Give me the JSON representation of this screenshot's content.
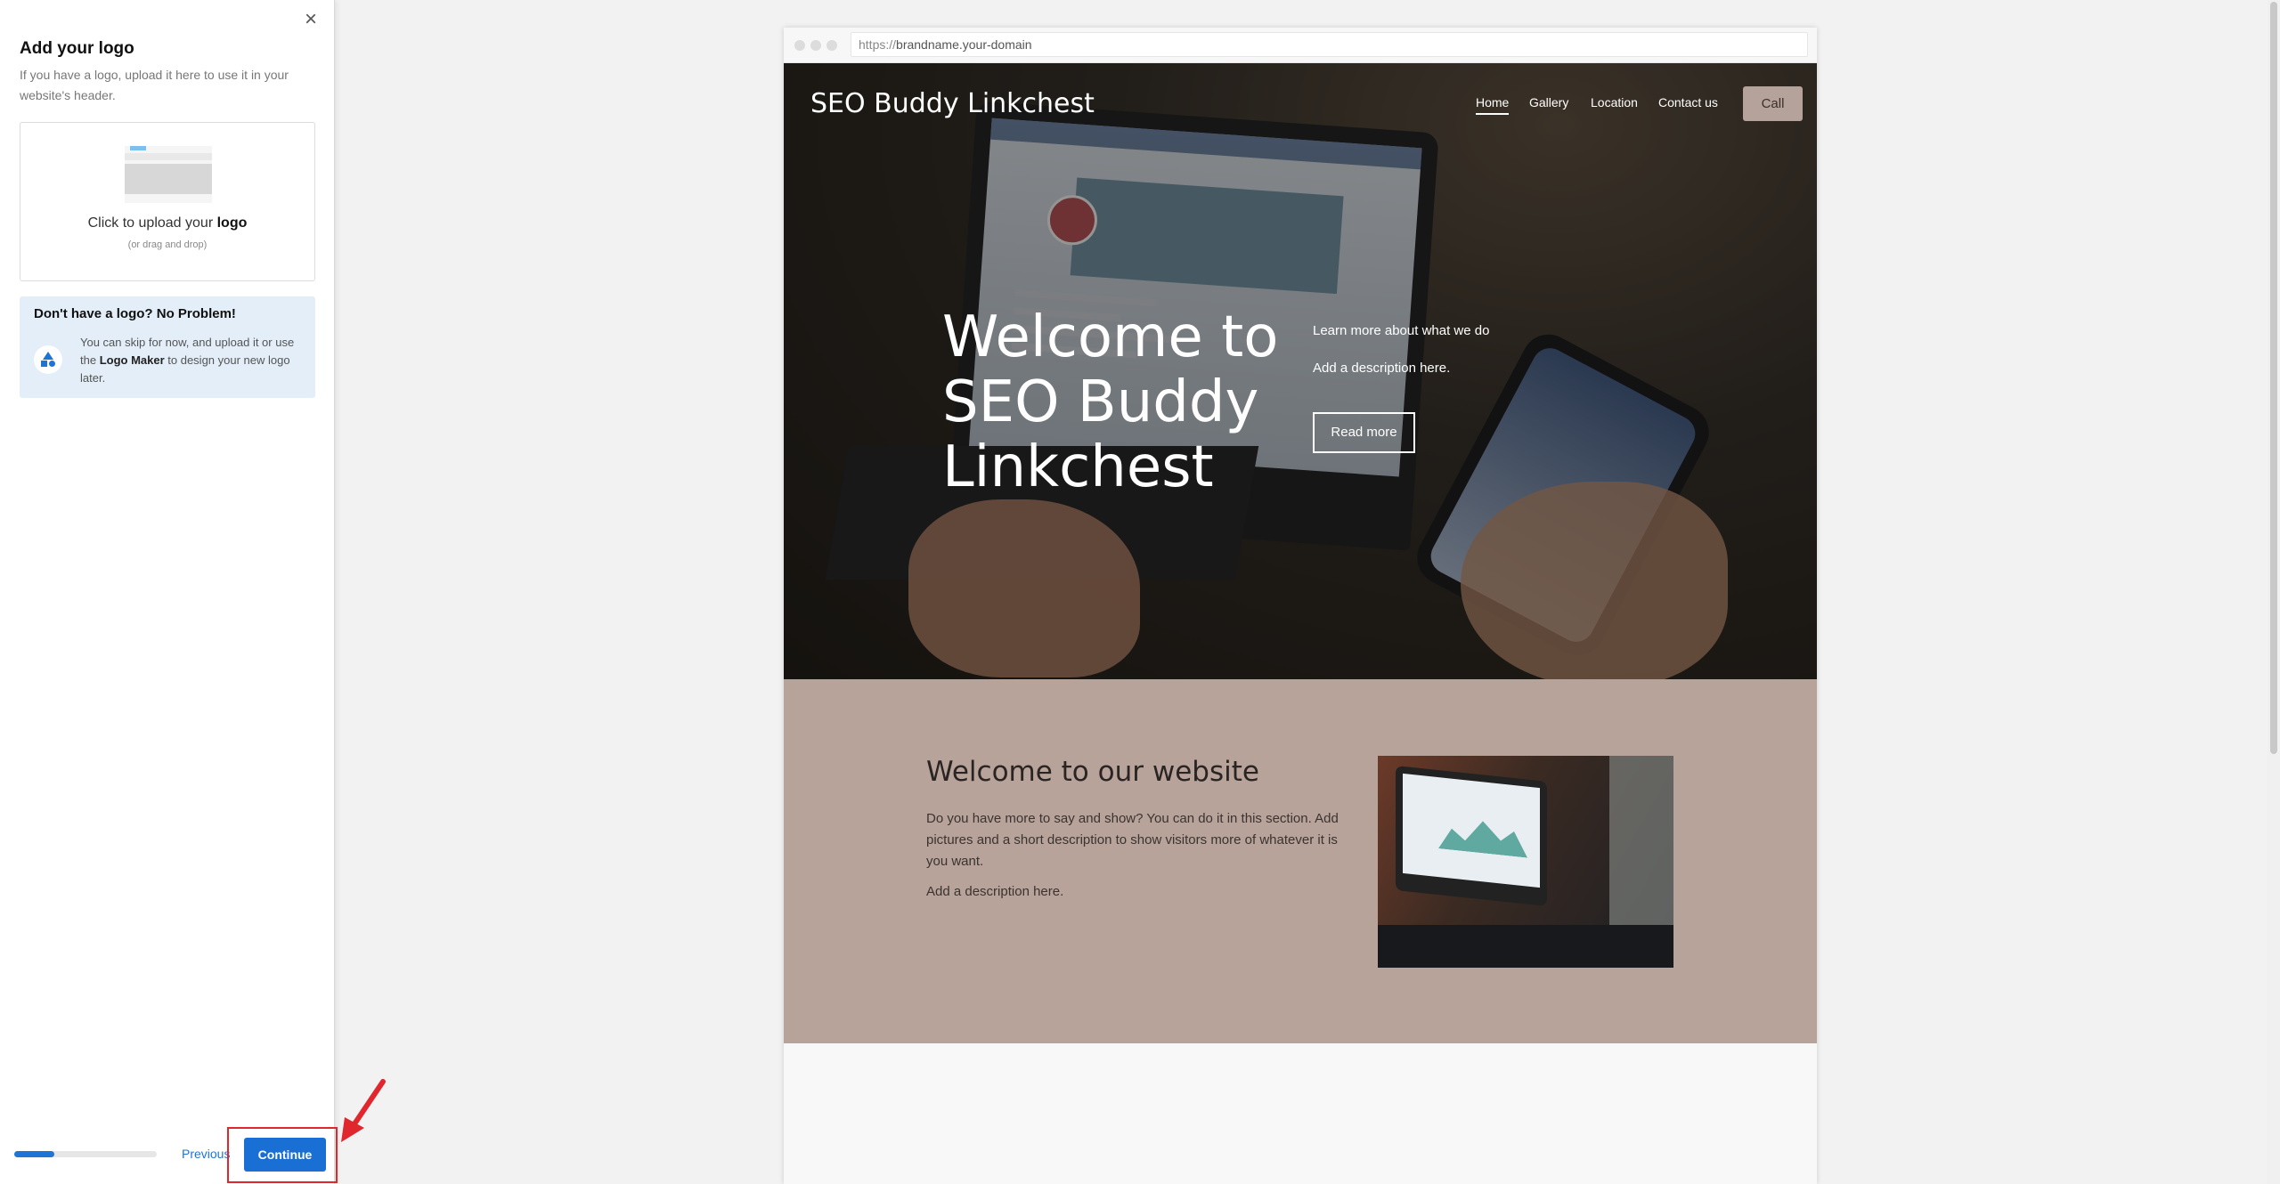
{
  "panel": {
    "close_glyph": "×",
    "title": "Add your logo",
    "subtitle": "If you have a logo, upload it here to use it in your website's header.",
    "upload": {
      "title_prefix": "Click to upload your ",
      "title_bold": "logo",
      "hint": "(or drag and drop)"
    },
    "nologo": {
      "heading": "Don't have a logo? No Problem!",
      "text_1": "You can skip for now, and upload it or use the ",
      "text_bold": "Logo Maker",
      "text_2": " to design your new logo later.",
      "icon": "shapes-icon"
    },
    "progress": 0.28,
    "previous_label": "Previous",
    "continue_label": "Continue"
  },
  "preview": {
    "url_prefix": "https://",
    "url_domain": "brandname.your-domain",
    "brand": "SEO Buddy Linkchest",
    "nav": [
      "Home",
      "Gallery",
      "Location",
      "Contact us"
    ],
    "call_label": "Call",
    "headline": "Welcome to SEO Buddy Linkchest",
    "learn_more": "Learn more about what we do",
    "hero_description": "Add a description here.",
    "read_more": "Read more",
    "about": {
      "heading": "Welcome to our website",
      "body": "Do you have more to say and show? You can do it in this section. Add pictures and a short description to show visitors more of whatever it is you want.",
      "description": "Add a description here."
    },
    "contact_icon": "envelope-icon"
  },
  "colors": {
    "accent": "#1a6fd4",
    "about_bg": "#b8a39b",
    "call_bg": "#b5a29b",
    "annotation_red": "#e0272d"
  }
}
